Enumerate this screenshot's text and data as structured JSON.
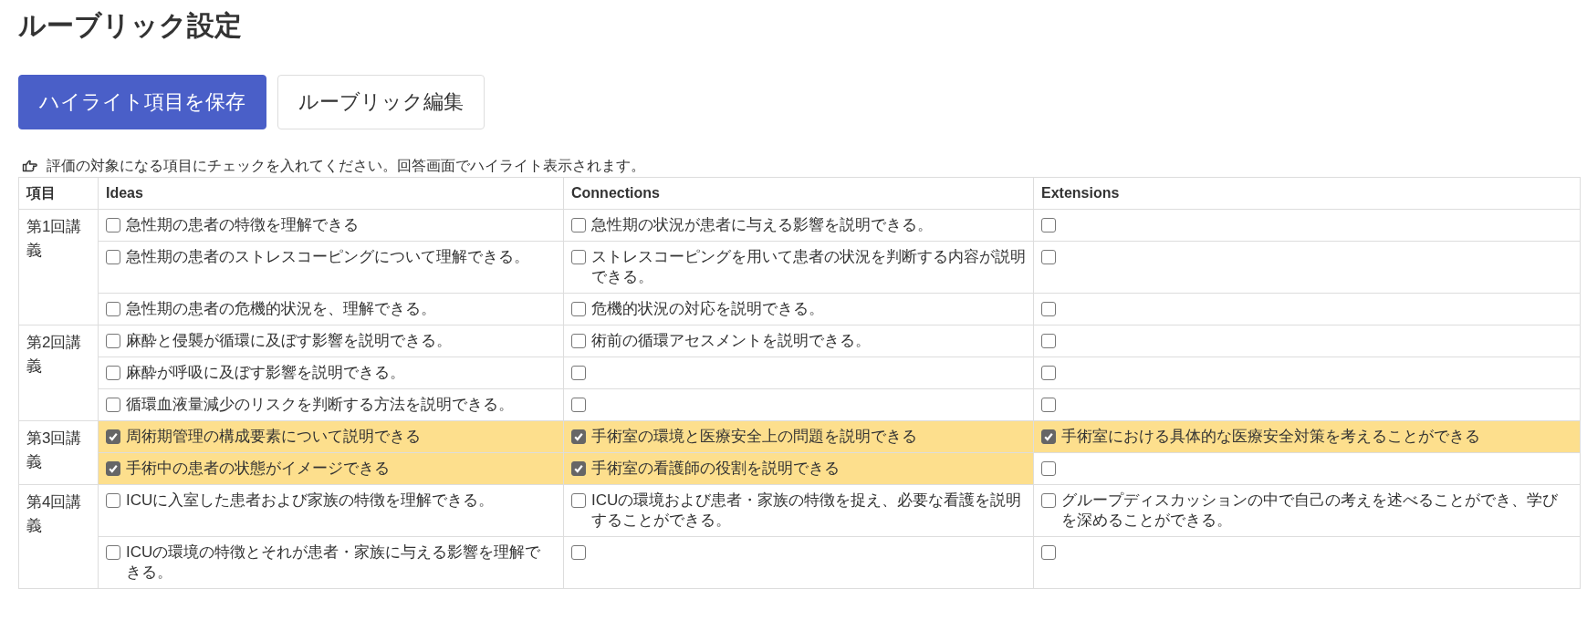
{
  "title": "ルーブリック設定",
  "buttons": [
    {
      "kind": "primary",
      "label": "ハイライト項目を保存"
    },
    {
      "kind": "secondary",
      "label": "ルーブリック編集"
    }
  ],
  "hint": "評価の対象になる項目にチェックを入れてください。回答画面でハイライト表示されます。",
  "table": {
    "columns": [
      "項目",
      "Ideas",
      "Connections",
      "Extensions"
    ],
    "lectures": [
      {
        "label": "第1回講義",
        "rows": [
          [
            {
              "text": "急性期の患者の特徴を理解できる",
              "checked": false
            },
            {
              "text": "急性期の状況が患者に与える影響を説明できる。",
              "checked": false
            },
            {
              "checked": false
            }
          ],
          [
            {
              "text": "急性期の患者のストレスコーピングについて理解できる。",
              "checked": false
            },
            {
              "text": "ストレスコーピングを用いて患者の状況を判断する内容が説明できる。",
              "checked": false
            },
            {
              "checked": false
            }
          ],
          [
            {
              "text": "急性期の患者の危機的状況を、理解できる。",
              "checked": false
            },
            {
              "text": "危機的状況の対応を説明できる。",
              "checked": false
            },
            {
              "checked": false
            }
          ]
        ]
      },
      {
        "label": "第2回講義",
        "rows": [
          [
            {
              "text": "麻酔と侵襲が循環に及ぼす影響を説明できる。",
              "checked": false
            },
            {
              "text": "術前の循環アセスメントを説明できる。",
              "checked": false
            },
            {
              "checked": false
            }
          ],
          [
            {
              "text": "麻酔が呼吸に及ぼす影響を説明できる。",
              "checked": false
            },
            {
              "checked": false
            },
            {
              "checked": false
            }
          ],
          [
            {
              "text": "循環血液量減少のリスクを判断する方法を説明できる。",
              "checked": false
            },
            {
              "checked": false
            },
            {
              "checked": false
            }
          ]
        ]
      },
      {
        "label": "第3回講義",
        "rows": [
          [
            {
              "text": "周術期管理の構成要素について説明できる",
              "checked": true
            },
            {
              "text": "手術室の環境と医療安全上の問題を説明できる",
              "checked": true
            },
            {
              "text": "手術室における具体的な医療安全対策を考えることができる",
              "checked": true
            }
          ],
          [
            {
              "text": "手術中の患者の状態がイメージできる",
              "checked": true
            },
            {
              "text": "手術室の看護師の役割を説明できる",
              "checked": true
            },
            {
              "checked": false
            }
          ]
        ]
      },
      {
        "label": "第4回講義",
        "rows": [
          [
            {
              "text": "ICUに入室した患者および家族の特徴を理解できる。",
              "checked": false
            },
            {
              "text": "ICUの環境および患者・家族の特徴を捉え、必要な看護を説明することができる。",
              "checked": false
            },
            {
              "text": "グループディスカッションの中で自己の考えを述べることができ、学びを深めることができる。",
              "checked": false
            }
          ],
          [
            {
              "text": "ICUの環境の特徴とそれが患者・家族に与える影響を理解できる。",
              "checked": false
            },
            {
              "checked": false
            },
            {
              "checked": false
            }
          ]
        ]
      }
    ]
  }
}
